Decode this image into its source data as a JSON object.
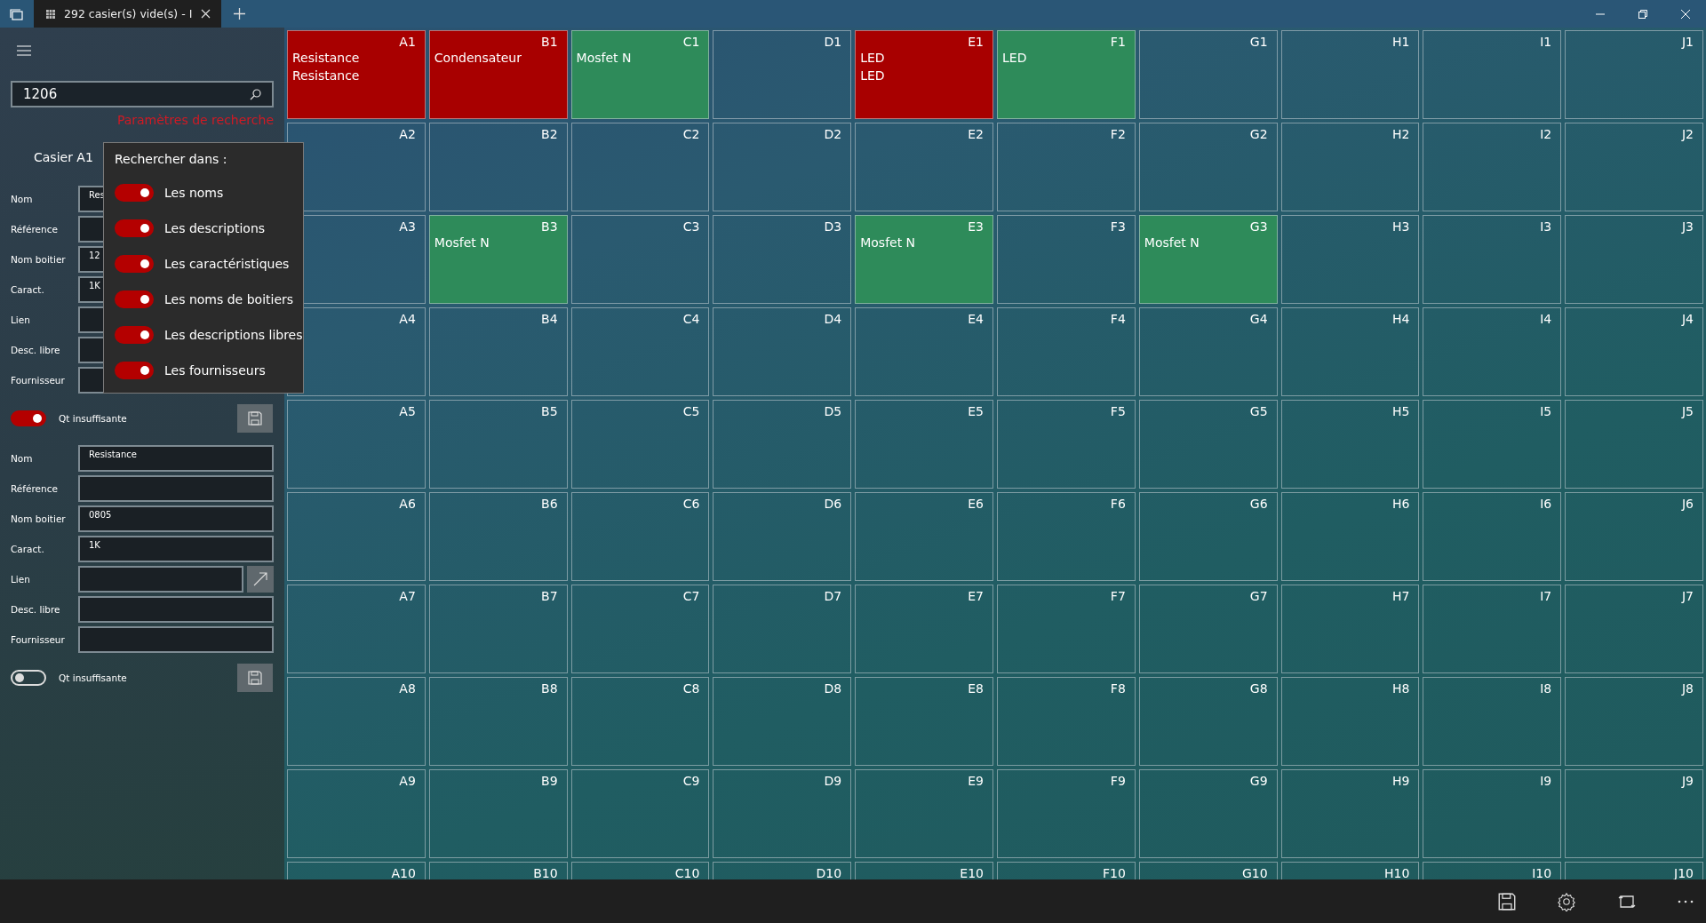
{
  "tab": {
    "title": "292 casier(s) vide(s) - I"
  },
  "search": {
    "value": "1206",
    "settings_link": "Paramètres de recherche"
  },
  "popup": {
    "title": "Rechercher dans :",
    "options": [
      {
        "label": "Les noms",
        "on": true
      },
      {
        "label": "Les descriptions",
        "on": true
      },
      {
        "label": "Les caractéristiques",
        "on": true
      },
      {
        "label": "Les noms de boitiers",
        "on": true
      },
      {
        "label": "Les descriptions libres",
        "on": true
      },
      {
        "label": "Les fournisseurs",
        "on": true
      }
    ]
  },
  "forms": [
    {
      "title": "Casier A1",
      "fields": [
        {
          "label": "Nom",
          "value": "Res",
          "kind": "text"
        },
        {
          "label": "Référence",
          "kind": "text"
        },
        {
          "label": "Nom boitier",
          "value": "12",
          "kind": "text"
        },
        {
          "label": "Caract.",
          "value": "1K",
          "kind": "text"
        },
        {
          "label": "Lien",
          "kind": "text"
        },
        {
          "label": "Desc. libre",
          "kind": "text"
        },
        {
          "label": "Fournisseur",
          "kind": "text"
        }
      ],
      "toggle": {
        "label": "Qt insuffisante",
        "on": true
      }
    },
    {
      "fields": [
        {
          "label": "Nom",
          "value": "Resistance",
          "kind": "text"
        },
        {
          "label": "Référence",
          "kind": "text"
        },
        {
          "label": "Nom boitier",
          "value": "0805",
          "kind": "text"
        },
        {
          "label": "Caract.",
          "value": "1K",
          "kind": "text"
        },
        {
          "label": "Lien",
          "kind": "link"
        },
        {
          "label": "Desc. libre",
          "kind": "text"
        },
        {
          "label": "Fournisseur",
          "kind": "text"
        }
      ],
      "toggle": {
        "label": "Qt insuffisante",
        "on": false
      }
    }
  ],
  "cells": [
    {
      "label": "A1",
      "color": "#a80000",
      "lines": [
        "Resistance",
        "Resistance"
      ]
    },
    {
      "label": "B1",
      "color": "#a80000",
      "lines": [
        "Condensateur"
      ]
    },
    {
      "label": "C1",
      "color": "#2e8b5a",
      "lines": [
        "Mosfet N"
      ]
    },
    {
      "label": "D1"
    },
    {
      "label": "E1",
      "color": "#a80000",
      "lines": [
        "LED",
        "LED"
      ]
    },
    {
      "label": "F1",
      "color": "#2e8b5a",
      "lines": [
        "LED"
      ]
    },
    {
      "label": "G1"
    },
    {
      "label": "H1"
    },
    {
      "label": "I1"
    },
    {
      "label": "J1"
    },
    {
      "label": "A2"
    },
    {
      "label": "B2"
    },
    {
      "label": "C2"
    },
    {
      "label": "D2"
    },
    {
      "label": "E2"
    },
    {
      "label": "F2"
    },
    {
      "label": "G2"
    },
    {
      "label": "H2"
    },
    {
      "label": "I2"
    },
    {
      "label": "J2"
    },
    {
      "label": "A3"
    },
    {
      "label": "B3",
      "color": "#2e8b5a",
      "lines": [
        "Mosfet N"
      ]
    },
    {
      "label": "C3"
    },
    {
      "label": "D3"
    },
    {
      "label": "E3",
      "color": "#2e8b5a",
      "lines": [
        "Mosfet N"
      ]
    },
    {
      "label": "F3"
    },
    {
      "label": "G3",
      "color": "#2e8b5a",
      "lines": [
        "Mosfet N"
      ]
    },
    {
      "label": "H3"
    },
    {
      "label": "I3"
    },
    {
      "label": "J3"
    },
    {
      "label": "A4"
    },
    {
      "label": "B4"
    },
    {
      "label": "C4"
    },
    {
      "label": "D4"
    },
    {
      "label": "E4"
    },
    {
      "label": "F4"
    },
    {
      "label": "G4"
    },
    {
      "label": "H4"
    },
    {
      "label": "I4"
    },
    {
      "label": "J4"
    },
    {
      "label": "A5"
    },
    {
      "label": "B5"
    },
    {
      "label": "C5"
    },
    {
      "label": "D5"
    },
    {
      "label": "E5"
    },
    {
      "label": "F5"
    },
    {
      "label": "G5"
    },
    {
      "label": "H5"
    },
    {
      "label": "I5"
    },
    {
      "label": "J5"
    },
    {
      "label": "A6"
    },
    {
      "label": "B6"
    },
    {
      "label": "C6"
    },
    {
      "label": "D6"
    },
    {
      "label": "E6"
    },
    {
      "label": "F6"
    },
    {
      "label": "G6"
    },
    {
      "label": "H6"
    },
    {
      "label": "I6"
    },
    {
      "label": "J6"
    },
    {
      "label": "A7"
    },
    {
      "label": "B7"
    },
    {
      "label": "C7"
    },
    {
      "label": "D7"
    },
    {
      "label": "E7"
    },
    {
      "label": "F7"
    },
    {
      "label": "G7"
    },
    {
      "label": "H7"
    },
    {
      "label": "I7"
    },
    {
      "label": "J7"
    },
    {
      "label": "A8"
    },
    {
      "label": "B8"
    },
    {
      "label": "C8"
    },
    {
      "label": "D8"
    },
    {
      "label": "E8"
    },
    {
      "label": "F8"
    },
    {
      "label": "G8"
    },
    {
      "label": "H8"
    },
    {
      "label": "I8"
    },
    {
      "label": "J8"
    },
    {
      "label": "A9"
    },
    {
      "label": "B9"
    },
    {
      "label": "C9"
    },
    {
      "label": "D9"
    },
    {
      "label": "E9"
    },
    {
      "label": "F9"
    },
    {
      "label": "G9"
    },
    {
      "label": "H9"
    },
    {
      "label": "I9"
    },
    {
      "label": "J9"
    },
    {
      "label": "A10"
    },
    {
      "label": "B10"
    },
    {
      "label": "C10"
    },
    {
      "label": "D10"
    },
    {
      "label": "E10"
    },
    {
      "label": "F10"
    },
    {
      "label": "G10"
    },
    {
      "label": "H10"
    },
    {
      "label": "I10"
    },
    {
      "label": "J10"
    }
  ]
}
